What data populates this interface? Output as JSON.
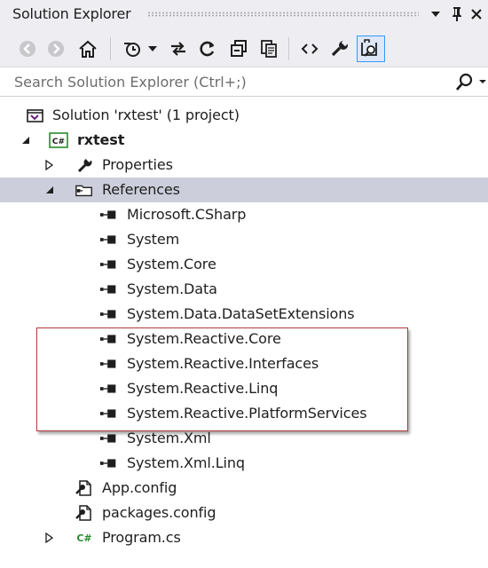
{
  "window": {
    "title": "Solution Explorer"
  },
  "toolbar": {
    "items": [
      "back-icon",
      "forward-icon",
      "home-icon",
      "history-icon",
      "dropdown-icon",
      "sync-icon",
      "refresh-icon",
      "collapse-all-icon",
      "show-all-files-icon",
      "view-code-icon",
      "properties-icon",
      "preview-selected-icon"
    ],
    "preview_active": true
  },
  "search": {
    "placeholder": "Search Solution Explorer (Ctrl+;)"
  },
  "tree": {
    "solution": "Solution 'rxtest' (1 project)",
    "project": "rxtest",
    "properties": "Properties",
    "references": "References",
    "refs": [
      "Microsoft.CSharp",
      "System",
      "System.Core",
      "System.Data",
      "System.Data.DataSetExtensions",
      "System.Reactive.Core",
      "System.Reactive.Interfaces",
      "System.Reactive.Linq",
      "System.Reactive.PlatformServices",
      "System.Xml",
      "System.Xml.Linq"
    ],
    "app_config": "App.config",
    "packages_config": "packages.config",
    "program_cs": "Program.cs",
    "cs_badge": "C#"
  },
  "colors": {
    "selection": "#cccedb",
    "highlight_border": "#b03a3a",
    "chrome": "#eeeef2"
  }
}
